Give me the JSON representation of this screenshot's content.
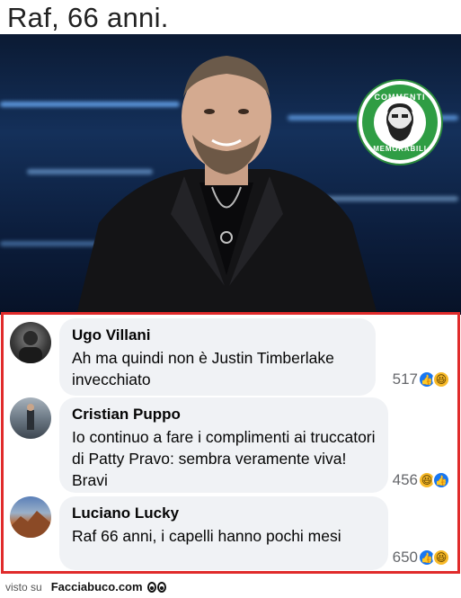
{
  "meme": {
    "title": "Raf, 66 anni.",
    "logo_top": "COMMENTI",
    "logo_bottom": "MEMORABILI"
  },
  "comments": [
    {
      "author": "Ugo Villani",
      "text": "Ah ma quindi non è Justin Timberlake invecchiato",
      "reaction_count": "517",
      "reaction_icons": [
        "like-icon",
        "haha-icon"
      ]
    },
    {
      "author": "Cristian Puppo",
      "text": "Io continuo a fare i complimenti ai truccatori di Patty Pravo: sembra veramente viva! Bravi",
      "reaction_count": "456",
      "reaction_icons": [
        "haha-icon",
        "like-icon"
      ]
    },
    {
      "author": "Luciano Lucky",
      "text": "Raf 66 anni, i capelli hanno pochi mesi",
      "reaction_count": "650",
      "reaction_icons": [
        "like-icon",
        "haha-icon"
      ]
    }
  ],
  "footer": {
    "label": "visto su",
    "site": "Facciabuco.com"
  },
  "colors": {
    "frame": "#e02b2b",
    "bubble": "#f0f2f5",
    "like": "#1877f2",
    "haha": "#f7b928",
    "logo": "#2f9d44"
  }
}
